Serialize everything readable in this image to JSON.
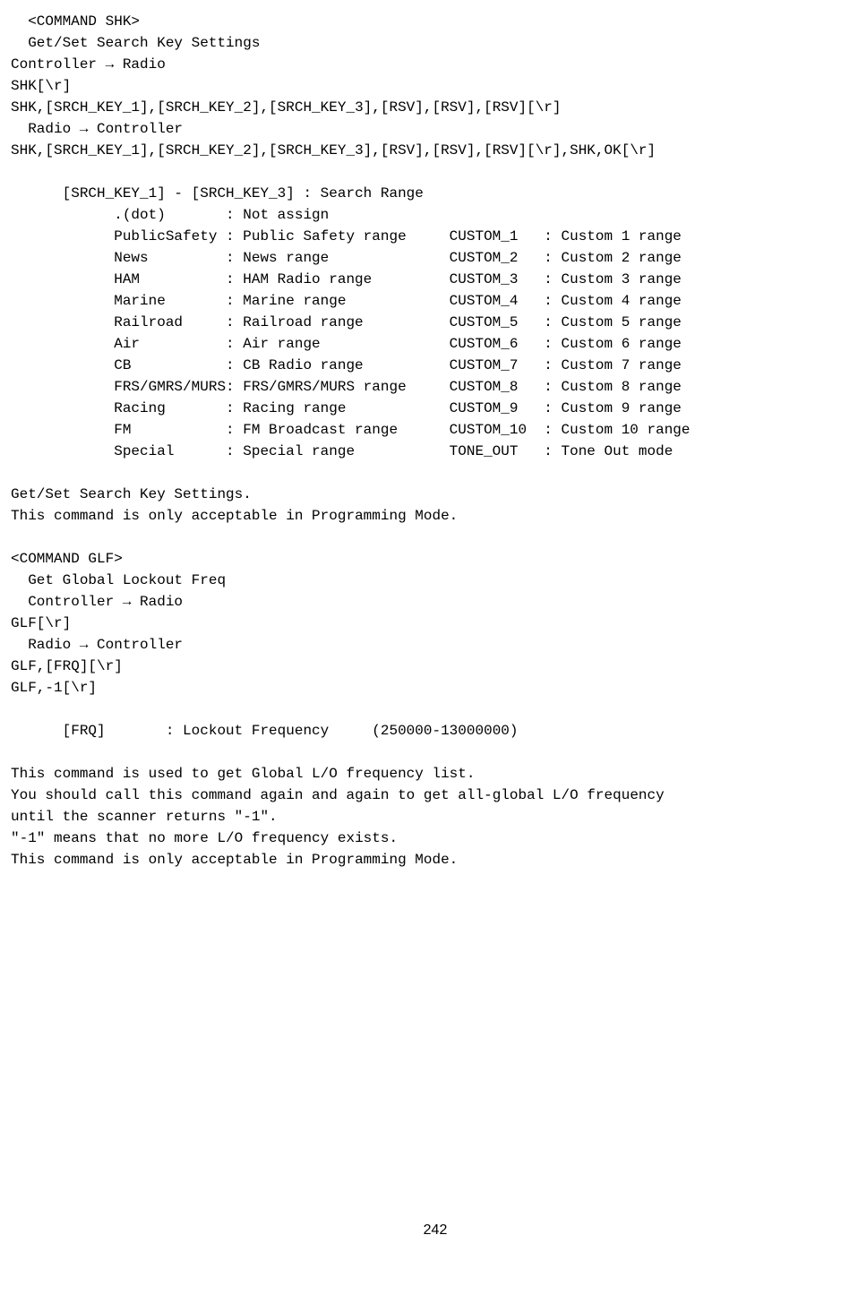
{
  "shk": {
    "header": "<COMMAND SHK>",
    "title": "Get/Set Search Key Settings",
    "dir1": "Controller → Radio",
    "line1": "SHK[\\r]",
    "line2": "SHK,[SRCH_KEY_1],[SRCH_KEY_2],[SRCH_KEY_3],[RSV],[RSV],[RSV][\\r]",
    "dir2": "Radio → Controller",
    "line3": "SHK,[SRCH_KEY_1],[SRCH_KEY_2],[SRCH_KEY_3],[RSV],[RSV],[RSV][\\r],SHK,OK[\\r]",
    "range_header": "[SRCH_KEY_1] - [SRCH_KEY_3]   : Search Range",
    "defs": [
      {
        "l": ".(dot)",
        "ld": ": Not assign",
        "r": "",
        "rd": ""
      },
      {
        "l": "PublicSafety",
        "ld": ": Public Safety range",
        "r": "CUSTOM_1",
        "rd": ": Custom 1 range"
      },
      {
        "l": "News",
        "ld": ": News range",
        "r": "CUSTOM_2",
        "rd": ": Custom 2 range"
      },
      {
        "l": "HAM",
        "ld": ": HAM Radio range",
        "r": "CUSTOM_3",
        "rd": ": Custom 3 range"
      },
      {
        "l": "Marine",
        "ld": ": Marine range",
        "r": "CUSTOM_4",
        "rd": ": Custom 4 range"
      },
      {
        "l": "Railroad",
        "ld": ": Railroad range",
        "r": "CUSTOM_5",
        "rd": ": Custom 5 range"
      },
      {
        "l": "Air",
        "ld": ": Air range",
        "r": "CUSTOM_6",
        "rd": ": Custom 6 range"
      },
      {
        "l": "CB",
        "ld": ": CB Radio range",
        "r": "CUSTOM_7",
        "rd": ": Custom 7 range"
      },
      {
        "l": "FRS/GMRS/MURS",
        "ld": ": FRS/GMRS/MURS range",
        "r": "CUSTOM_8",
        "rd": ": Custom 8 range"
      },
      {
        "l": "Racing",
        "ld": ": Racing range",
        "r": "CUSTOM_9",
        "rd": ": Custom 9 range"
      },
      {
        "l": "FM",
        "ld": ": FM Broadcast range",
        "r": "CUSTOM_10",
        "rd": ": Custom 10 range"
      },
      {
        "l": "Special",
        "ld": ": Special range",
        "r": "TONE_OUT",
        "rd": ": Tone Out mode"
      }
    ],
    "footer1": "Get/Set Search Key Settings.",
    "footer2": "This command is only acceptable in Programming Mode."
  },
  "glf": {
    "header": "<COMMAND GLF>",
    "title": "Get Global Lockout Freq",
    "dir1": "Controller → Radio",
    "line1": "GLF[\\r]",
    "dir2": "Radio → Controller",
    "line2": "GLF,[FRQ][\\r]",
    "line3": "GLF,-1[\\r]",
    "param_line": "[FRQ]       : Lockout Frequency     (250000-13000000)",
    "footer1": "This command is used to get Global L/O frequency list.",
    "footer2": "You should call this command again and again to get all-global L/O frequency",
    "footer3": "until the scanner returns \"-1\".",
    "footer4": "\"-1\" means that no more L/O frequency exists.",
    "footer5": "This command is only acceptable in Programming Mode."
  },
  "page_number": "242"
}
